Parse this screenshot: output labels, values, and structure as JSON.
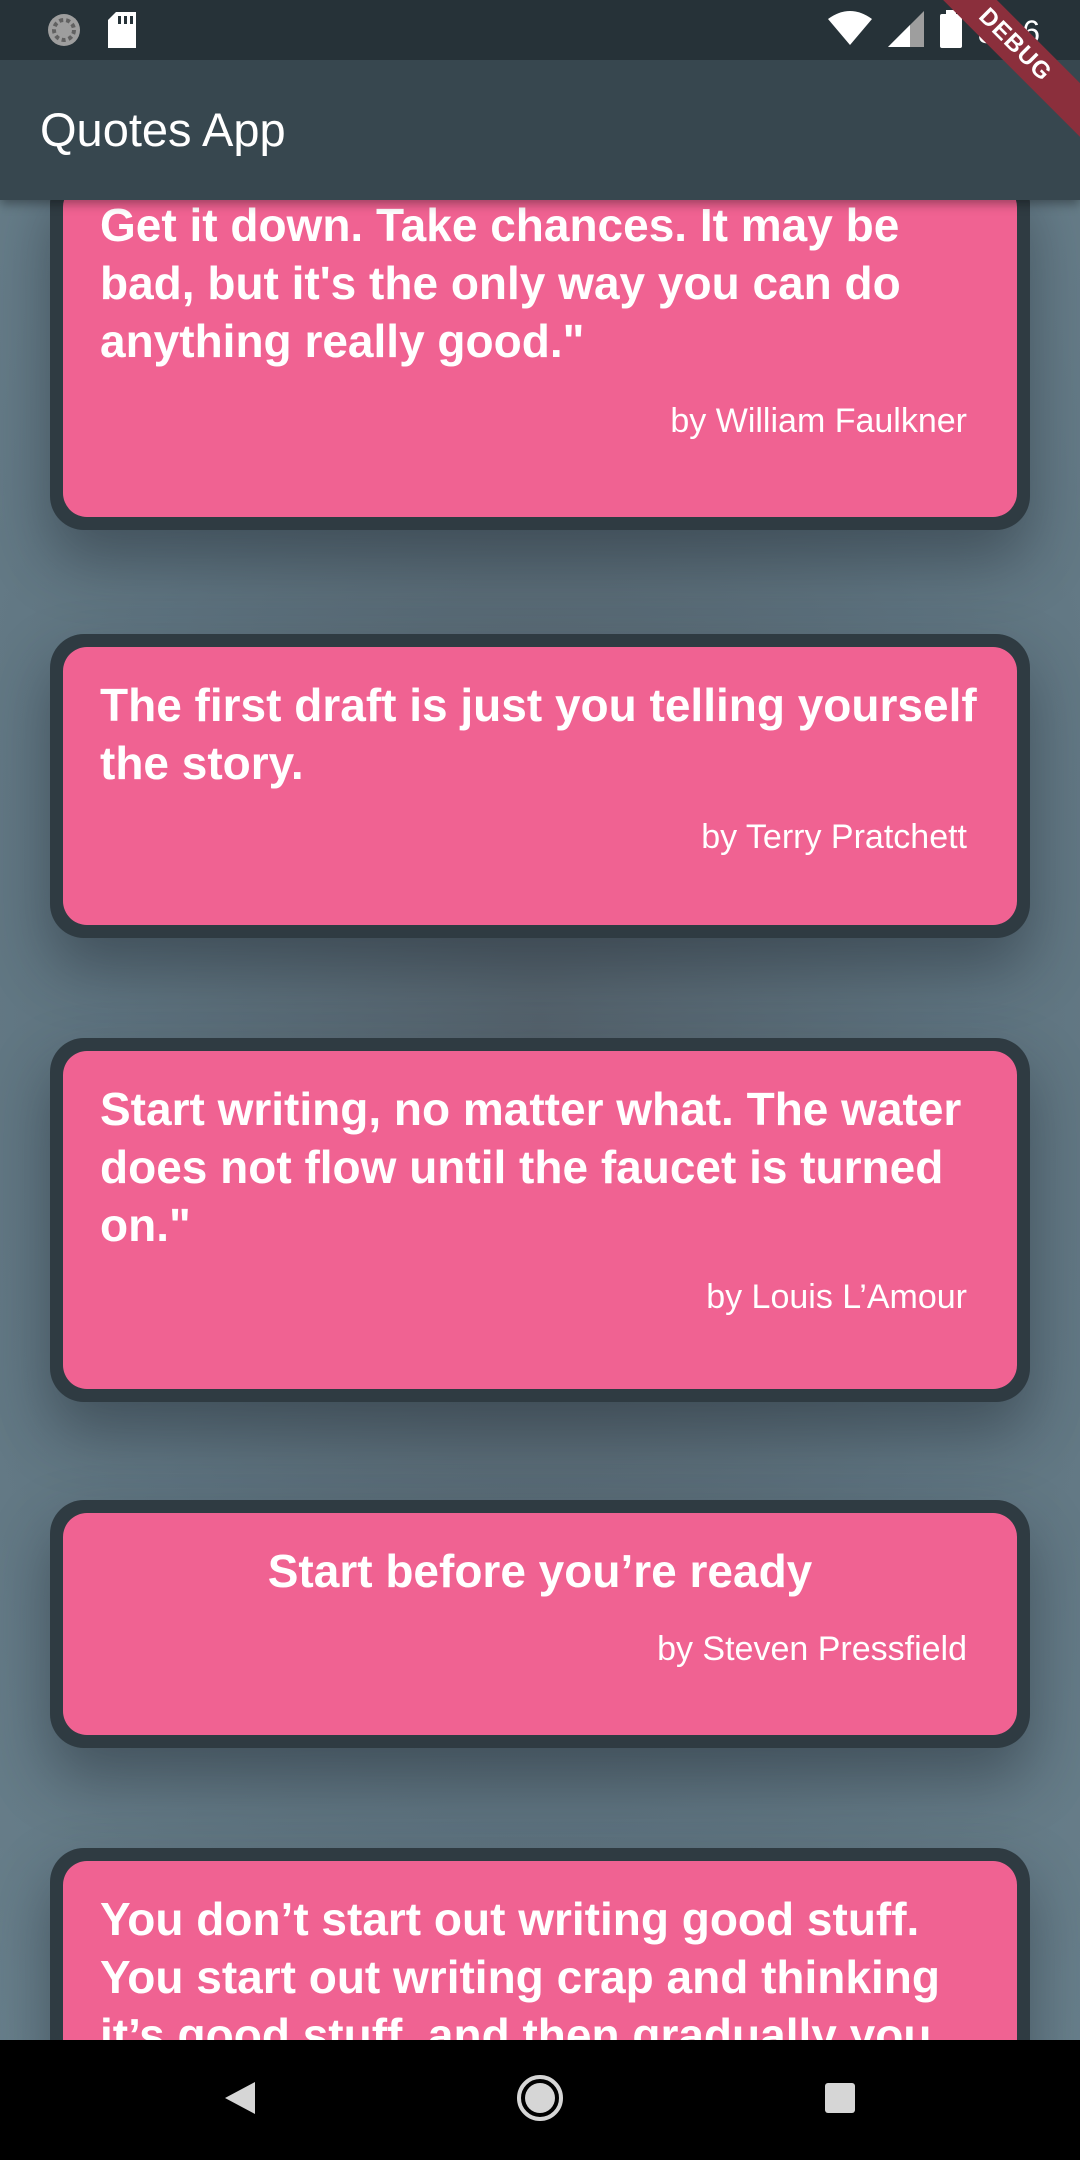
{
  "status_bar": {
    "time": "8:26",
    "icons": [
      "loading-icon",
      "sd-card-icon",
      "wifi-icon",
      "signal-icon",
      "battery-icon"
    ]
  },
  "app_bar": {
    "title": "Quotes App"
  },
  "debug_banner": "DEBUG",
  "quotes": [
    {
      "text": "Get it down. Take chances. It may be bad, but it's the only way you can do anything really good.\"",
      "author": "by William Faulkner"
    },
    {
      "text": "The first draft is just you telling yourself the story.",
      "author": "by Terry Pratchett"
    },
    {
      "text": "Start writing, no matter what. The water does not flow until the faucet is turned on.\"",
      "author": "by Louis L’Amour"
    },
    {
      "text": "Start before you’re ready",
      "author": "by Steven Pressfield"
    },
    {
      "text": "You don’t start out writing good stuff. You start out writing crap and thinking it’s good stuff, and then gradually you",
      "author": ""
    }
  ],
  "nav_bar": {
    "buttons": [
      "back-icon",
      "home-icon",
      "recents-icon"
    ]
  },
  "colors": {
    "status_bar": "#263238",
    "app_bar": "#37474f",
    "background": "#607d8b",
    "card_border": "#2f3b42",
    "card_fill": "#f06292",
    "text": "#ffffff"
  }
}
